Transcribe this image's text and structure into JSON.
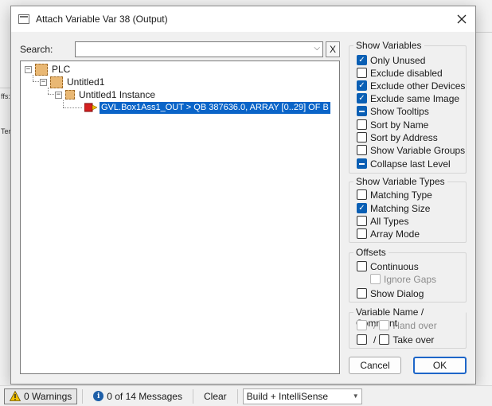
{
  "background": {
    "fragment_offs": "ffs:",
    "fragment_ter": "Ter:"
  },
  "dialog": {
    "title": "Attach Variable Var 38 (Output)",
    "search_label": "Search:",
    "search_value": "",
    "clear_symbol": "X",
    "ok_label": "OK",
    "cancel_label": "Cancel"
  },
  "tree": {
    "nodes": [
      {
        "label": "PLC",
        "expander": "−"
      },
      {
        "label": "Untitled1",
        "expander": "−"
      },
      {
        "label": "Untitled1 Instance",
        "expander": "−"
      },
      {
        "label": "GVL.Box1Ass1_OUT    >    QB 387636.0, ARRAY [0..29] OF B"
      }
    ]
  },
  "show_variables": {
    "title": "Show Variables",
    "options": [
      {
        "label": "Only Unused",
        "state": "checked"
      },
      {
        "label": "Exclude disabled",
        "state": "unchecked"
      },
      {
        "label": "Exclude other Devices",
        "state": "checked"
      },
      {
        "label": "Exclude same Image",
        "state": "checked"
      },
      {
        "label": "Show Tooltips",
        "state": "indeterminate"
      },
      {
        "label": "Sort by Name",
        "state": "unchecked"
      },
      {
        "label": "Sort by Address",
        "state": "unchecked"
      },
      {
        "label": "Show Variable Groups",
        "state": "unchecked"
      },
      {
        "label": "Collapse last Level",
        "state": "indeterminate"
      }
    ]
  },
  "show_variable_types": {
    "title": "Show Variable Types",
    "options": [
      {
        "label": "Matching Type",
        "state": "unchecked"
      },
      {
        "label": "Matching Size",
        "state": "checked"
      },
      {
        "label": "All Types",
        "state": "unchecked"
      },
      {
        "label": "Array Mode",
        "state": "unchecked"
      }
    ]
  },
  "offsets": {
    "title": "Offsets",
    "options": [
      {
        "label": "Continuous",
        "state": "unchecked"
      },
      {
        "label": "Ignore Gaps",
        "state": "disabled"
      },
      {
        "label": "Show Dialog",
        "state": "unchecked"
      }
    ]
  },
  "variable_name_comment": {
    "title": "Variable Name / Comment",
    "hand_over_label": "Hand over",
    "take_over_label": "Take over",
    "slash": "/"
  },
  "status_bar": {
    "warnings": "0 Warnings",
    "messages": "0 of 14 Messages",
    "clear": "Clear",
    "build_filter": "Build + IntelliSense"
  },
  "colors": {
    "accent": "#0a5fb4",
    "selection": "#0a64c8",
    "warning": "#f2c100"
  }
}
